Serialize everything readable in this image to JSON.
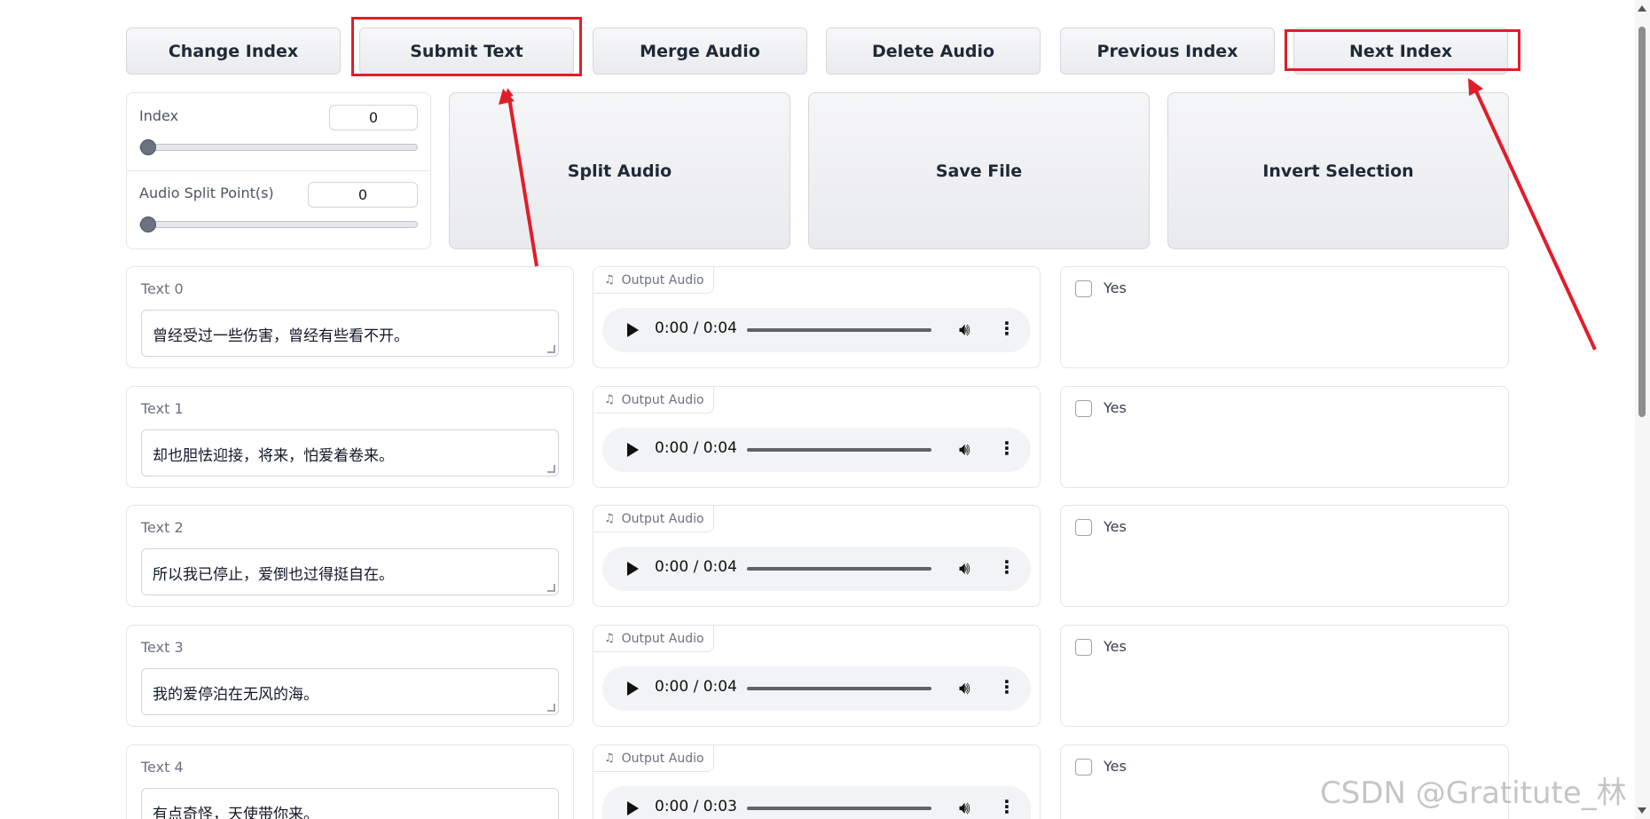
{
  "toolbar": {
    "change_index": "Change Index",
    "submit_text": "Submit Text",
    "merge_audio": "Merge Audio",
    "delete_audio": "Delete Audio",
    "previous_index": "Previous Index",
    "next_index": "Next Index"
  },
  "index_panel": {
    "index_label": "Index",
    "index_value": "0",
    "split_label": "Audio Split Point(s)",
    "split_value": "0"
  },
  "actions": {
    "split_audio": "Split Audio",
    "save_file": "Save File",
    "invert_selection": "Invert Selection"
  },
  "rows": [
    {
      "text_label": "Text 0",
      "text": "曾经受过一些伤害，曾经有些看不开。",
      "audio_label": "Output Audio",
      "time": "0:00 / 0:04",
      "check_label": "Yes"
    },
    {
      "text_label": "Text 1",
      "text": "却也胆怯迎接，将来，怕爱着卷来。",
      "audio_label": "Output Audio",
      "time": "0:00 / 0:04",
      "check_label": "Yes"
    },
    {
      "text_label": "Text 2",
      "text": "所以我已停止，爱倒也过得挺自在。",
      "audio_label": "Output Audio",
      "time": "0:00 / 0:04",
      "check_label": "Yes"
    },
    {
      "text_label": "Text 3",
      "text": "我的爱停泊在无风的海。",
      "audio_label": "Output Audio",
      "time": "0:00 / 0:04",
      "check_label": "Yes"
    },
    {
      "text_label": "Text 4",
      "text": "有点奇怪，天使带你来。",
      "audio_label": "Output Audio",
      "time": "0:00 / 0:03",
      "check_label": "Yes"
    }
  ],
  "watermark": "CSDN @Gratitute_林腾",
  "colors": {
    "annotation": "#e11d2a",
    "button_bg": "#eeeff1"
  }
}
